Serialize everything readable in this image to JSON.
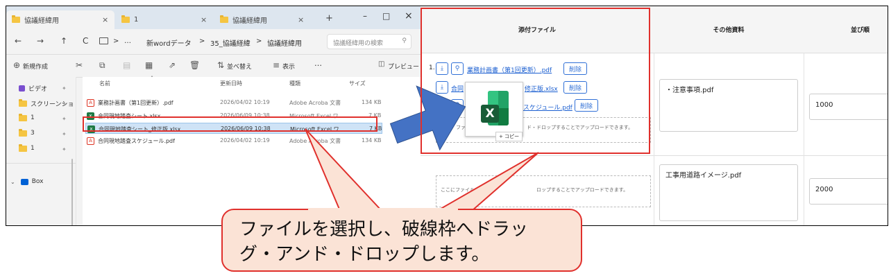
{
  "explorer": {
    "tabs": [
      {
        "label": "協議経緯用",
        "close": "×"
      },
      {
        "label": "1",
        "close": "×"
      },
      {
        "label": "協議経緯用",
        "close": "×"
      }
    ],
    "new_tab": "+",
    "window_controls": {
      "minimize": "–",
      "maximize": "□",
      "close": "×"
    },
    "nav": {
      "back": "←",
      "forward": "→",
      "up": "↑",
      "refresh": "C",
      "more": "…"
    },
    "breadcrumb": [
      "新wordデータ",
      "35_協議経緯",
      "協議経緯用"
    ],
    "breadcrumb_sep": ">",
    "search_placeholder": "協議経緯用の検索",
    "toolbar": {
      "new": "新規作成",
      "sort": "並べ替え",
      "view": "表示",
      "more": "…",
      "preview": "プレビュー"
    },
    "sidebar": [
      {
        "label": "ビデオ",
        "pin": "✦"
      },
      {
        "label": "スクリーンショ",
        "pin": "✦"
      },
      {
        "label": "1",
        "pin": "✦"
      },
      {
        "label": "3",
        "pin": "✦"
      },
      {
        "label": "1",
        "pin": "✦"
      },
      {
        "label": "Box",
        "pin": ""
      }
    ],
    "columns": {
      "name": "名前",
      "date": "更新日時",
      "type": "種類",
      "size": "サイズ"
    },
    "files": [
      {
        "name": "業務計画書（第1回更新）.pdf",
        "date": "2026/04/02 10:19",
        "type": "Adobe Acroba 文書",
        "size": "134 KB",
        "icon": "pdf"
      },
      {
        "name": "合同現地踏査シート.xlsx",
        "date": "2026/06/09 10:38",
        "type": "Microsoft Excel ワ...",
        "size": "7 KB",
        "icon": "xls"
      },
      {
        "name": "合同現地踏査シート_修正版.xlsx",
        "date": "2026/06/09 10:38",
        "type": "Microsoft Excel ワ...",
        "size": "7 KB",
        "icon": "xls"
      },
      {
        "name": "合同現地踏査スケジュール.pdf",
        "date": "2026/04/02 10:19",
        "type": "Adobe Acroba 文書",
        "size": "134 KB",
        "icon": "pdf"
      }
    ]
  },
  "form": {
    "headers": {
      "attachments": "添付ファイル",
      "other": "その他資料",
      "order": "並び順"
    },
    "row1": {
      "index": "1.",
      "files": [
        {
          "name": "業務計画書（第1回更新）.pdf",
          "delete": "削除"
        },
        {
          "name": "合同",
          "delete": "削除"
        },
        {
          "name": "スケジュール.pdf",
          "delete": "削除"
        }
      ],
      "file2_suffix": "修正版.xlsx",
      "dropzone_text": "ここにファイルをドラッグ・アンド・ドロップすることでアップロードできます。",
      "dropzone_text_visible": "ド・ドロップすることでアップロードできます。",
      "dropzone_prefix": "ファイ",
      "copy_badge": "+ コピー",
      "other": "・注意事項.pdf",
      "order": "1000"
    },
    "row2": {
      "dropzone_left": "ここにファイルを",
      "dropzone_right": "ロップすることでアップロードできます。",
      "other": "工事用道路イメージ.pdf",
      "order": "2000"
    }
  },
  "callout": {
    "line1": "ファイルを選択し、破線枠へドラッ",
    "line2": "グ・アンド・ドロップします。"
  },
  "colors": {
    "annotation_red": "#e0302c",
    "arrow_blue": "#4472c4",
    "callout_fill": "#fbe3d6",
    "excel_green": "#1f7a45",
    "link_blue": "#1b5fd1"
  }
}
